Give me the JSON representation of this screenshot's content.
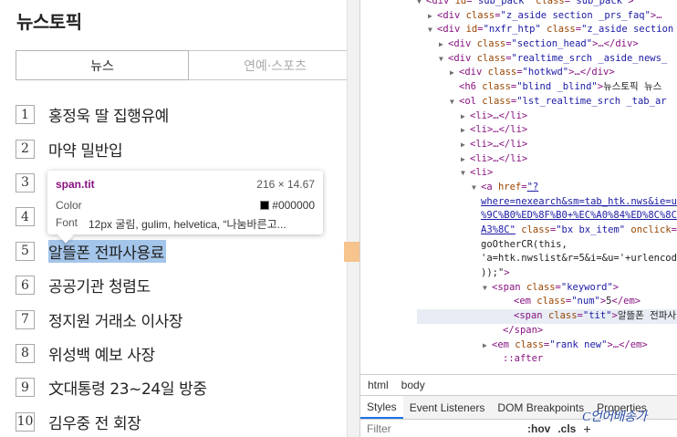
{
  "page": {
    "title": "뉴스토픽",
    "tabs": [
      {
        "label": "뉴스"
      },
      {
        "label": "연예·스포츠"
      }
    ],
    "ranks": [
      {
        "num": "1",
        "keyword": "홍정욱 딸 집행유예"
      },
      {
        "num": "2",
        "keyword": "마약 밀반입"
      },
      {
        "num": "3",
        "keyword": ""
      },
      {
        "num": "4",
        "keyword": ""
      },
      {
        "num": "5",
        "keyword": "알뜰폰 전파사용료"
      },
      {
        "num": "6",
        "keyword": "공공기관 청렴도"
      },
      {
        "num": "7",
        "keyword": "정지원 거래소 이사장"
      },
      {
        "num": "8",
        "keyword": "위성백 예보 사장"
      },
      {
        "num": "9",
        "keyword": "文대통령 23~24일 방중"
      },
      {
        "num": "10",
        "keyword": "김우중 전 회장"
      }
    ]
  },
  "tooltip": {
    "selector": "span.tit",
    "size": "216 × 14.67",
    "color_label": "Color",
    "color_value": "#000000",
    "font_label": "Font",
    "font_value": "12px 굴림, gulim, helvetica, “나눔바른고..."
  },
  "devtools": {
    "dom_lines": [
      {
        "indent": 62,
        "tri": "▼",
        "html": "&lt;div <a>id</a>=<v>\"sub_pack\"</v> <a>class</a>=<v>\"sub_pack\"</v>&gt;"
      },
      {
        "indent": 74,
        "tri": "▶",
        "html": "&lt;div <a>class</a>=<v>\"z_aside section _prs_faq\"</v>&gt;…"
      },
      {
        "indent": 74,
        "tri": "▼",
        "html": "&lt;div <a>id</a>=<v>\"nxfr_htp\"</v> <a>class</a>=<v>\"z_aside section</v>"
      },
      {
        "indent": 86,
        "tri": "▶",
        "html": "&lt;div <a>class</a>=<v>\"section_head\"</v>&gt;…&lt;/div&gt;"
      },
      {
        "indent": 86,
        "tri": "▼",
        "html": "&lt;div <a>class</a>=<v>\"realtime_srch _aside_news_</v>"
      },
      {
        "indent": 98,
        "tri": "▶",
        "html": "&lt;div <a>class</a>=<v>\"hotkwd\"</v>&gt;…&lt;/div&gt;"
      },
      {
        "indent": 98,
        "tri": "",
        "html": "&lt;h6 <a>class</a>=<v>\"blind _blind\"</v>&gt;<t>뉴스토픽 뉴스</t>"
      },
      {
        "indent": 98,
        "tri": "▼",
        "html": "&lt;ol <a>class</a>=<v>\"lst_realtime_srch _tab_ar</v>"
      },
      {
        "indent": 110,
        "tri": "▶",
        "html": "&lt;li&gt;…&lt;/li&gt;"
      },
      {
        "indent": 110,
        "tri": "▶",
        "html": "&lt;li&gt;…&lt;/li&gt;"
      },
      {
        "indent": 110,
        "tri": "▶",
        "html": "&lt;li&gt;…&lt;/li&gt;"
      },
      {
        "indent": 110,
        "tri": "▶",
        "html": "&lt;li&gt;…&lt;/li&gt;"
      },
      {
        "indent": 110,
        "tri": "▼",
        "html": "&lt;li&gt;"
      },
      {
        "indent": 122,
        "tri": "▼",
        "html": "&lt;a <a>href</a>=<l>\"?</l>"
      },
      {
        "indent": 122,
        "tri": "",
        "html": "<l>where=nexearch&amp;sm=tab_htk.nws&amp;ie=u</l>"
      },
      {
        "indent": 122,
        "tri": "",
        "html": "<l>%9C%B0%ED%8F%B0+%EC%A0%84%ED%8C%8C</l>"
      },
      {
        "indent": 122,
        "tri": "",
        "html": "<l>A3%8C\"</l> <a>class</a>=<v>\"bx bx_item\"</v> <a>onclick</a>="
      },
      {
        "indent": 122,
        "tri": "",
        "html": "<t>goOtherCR(this,</t>"
      },
      {
        "indent": 122,
        "tri": "",
        "html": "<t>'a=htk.nwslist&amp;r=5&amp;i=&amp;u='+urlencod</t>"
      },
      {
        "indent": 122,
        "tri": "",
        "html": "<t>));\"</t>&gt;"
      },
      {
        "indent": 134,
        "tri": "▼",
        "html": "&lt;span <a>class</a>=<v>\"keyword\"</v>&gt;"
      },
      {
        "indent": 158,
        "tri": "",
        "html": "&lt;em <a>class</a>=<v>\"num\"</v>&gt;<t>5</t>&lt;/em&gt;"
      },
      {
        "indent": 158,
        "tri": "",
        "html": "&lt;span <a>class</a>=<v>\"tit\"</v>&gt;<t>알뜰폰 전파사</t>",
        "selected": true
      },
      {
        "indent": 146,
        "tri": "",
        "html": "&lt;/span&gt;"
      },
      {
        "indent": 134,
        "tri": "▶",
        "html": "&lt;em <a>class</a>=<v>\"rank new\"</v>&gt;…&lt;/em&gt;"
      },
      {
        "indent": 146,
        "tri": "",
        "html": "::after"
      }
    ],
    "breadcrumbs": [
      "html",
      "body"
    ],
    "subtabs": [
      {
        "label": "Styles",
        "active": true
      },
      {
        "label": "Event Listeners"
      },
      {
        "label": "DOM Breakpoints"
      },
      {
        "label": "Properties"
      }
    ],
    "filter_placeholder": "Filter",
    "hov_label": ":hov",
    "cls_label": ".cls",
    "plus_label": "+"
  },
  "watermark": "C언어배송가"
}
